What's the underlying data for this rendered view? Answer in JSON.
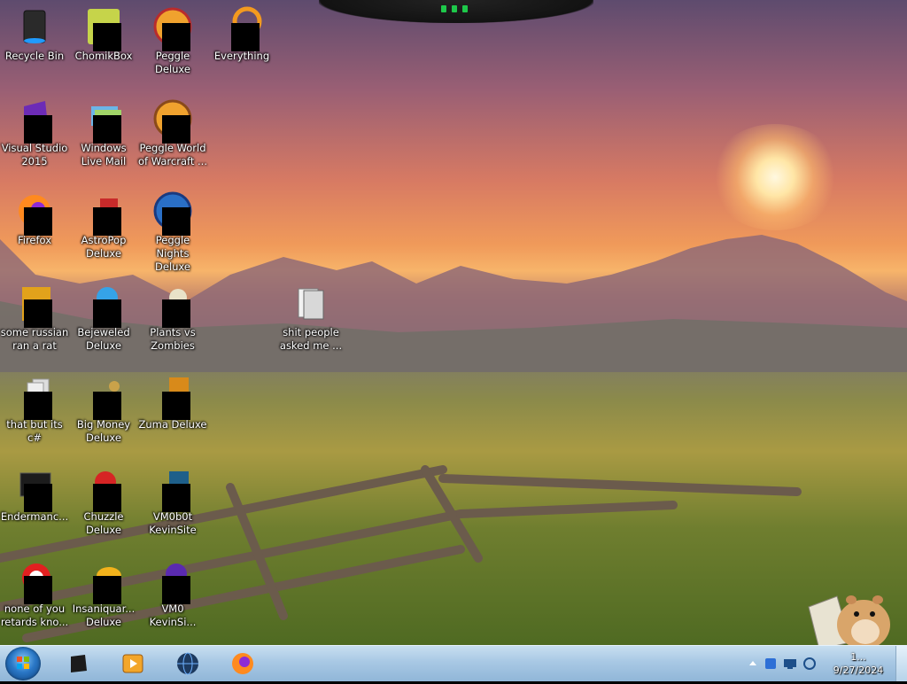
{
  "desktop": {
    "icons": [
      {
        "id": "recycle-bin",
        "label": "Recycle Bin"
      },
      {
        "id": "chomikbox",
        "label": "ChomikBox"
      },
      {
        "id": "peggle-deluxe",
        "label": "Peggle Deluxe"
      },
      {
        "id": "everything",
        "label": "Everything"
      },
      {
        "id": "visual-studio-2015",
        "label": "Visual Studio 2015"
      },
      {
        "id": "windows-live-mail",
        "label": "Windows Live Mail"
      },
      {
        "id": "peggle-world-of-warcraft",
        "label": "Peggle World of Warcraft ..."
      },
      {
        "id": "firefox",
        "label": "Firefox"
      },
      {
        "id": "astropop-deluxe",
        "label": "AstroPop Deluxe"
      },
      {
        "id": "peggle-nights-deluxe",
        "label": "Peggle Nights Deluxe"
      },
      {
        "id": "some-russian-ran-a-rat",
        "label": "some russian ran a rat"
      },
      {
        "id": "bejeweled-deluxe",
        "label": "Bejeweled Deluxe"
      },
      {
        "id": "plants-vs-zombies",
        "label": "Plants vs Zombies"
      },
      {
        "id": "shit-people-asked-me",
        "label": "shit people asked me ..."
      },
      {
        "id": "that-but-its-csharp",
        "label": "that but its c#"
      },
      {
        "id": "big-money-deluxe",
        "label": "Big Money Deluxe"
      },
      {
        "id": "zuma-deluxe",
        "label": "Zuma Deluxe"
      },
      {
        "id": "endermanch",
        "label": "Endermanc..."
      },
      {
        "id": "chuzzle-deluxe",
        "label": "Chuzzle Deluxe"
      },
      {
        "id": "vm0b0t-kevinsite",
        "label": "VM0b0t KevinSite"
      },
      {
        "id": "none-of-you-retards",
        "label": "none of you retards kno..."
      },
      {
        "id": "insaniquarium-deluxe",
        "label": "Insaniquar... Deluxe"
      },
      {
        "id": "vm0-kevinsi",
        "label": "VM0 KevinSi..."
      }
    ]
  },
  "taskbar": {
    "pinned": [
      {
        "id": "app-black-box",
        "icon": "black-box-icon"
      },
      {
        "id": "media-player",
        "icon": "media-player-icon"
      },
      {
        "id": "globe-app",
        "icon": "globe-icon"
      },
      {
        "id": "firefox",
        "icon": "firefox-icon"
      }
    ],
    "clock": {
      "time": "1...",
      "date": "9/27/2024"
    }
  },
  "colors": {
    "taskbar": "#a8c8e4",
    "start_orb": "#2a77c6",
    "gadget_light": "#1ec84a"
  }
}
